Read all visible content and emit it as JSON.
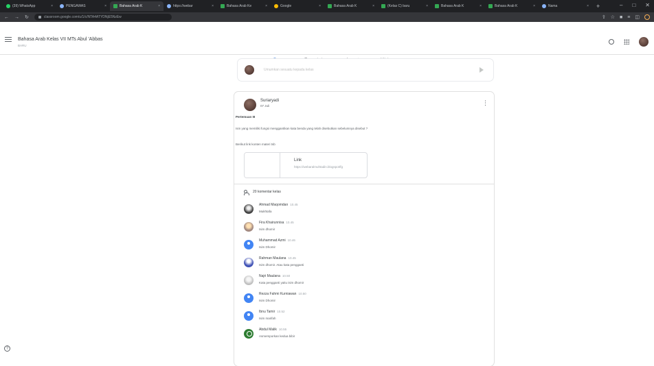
{
  "browser": {
    "tabs": [
      {
        "label": "(39) WhatsApp",
        "icon": "whatsapp-icon"
      },
      {
        "label": "PENGAWAS",
        "icon": "globe-icon"
      },
      {
        "label": "Bahasa Arab K",
        "icon": "classroom-icon",
        "active": true
      },
      {
        "label": "https://webar",
        "icon": "globe-icon"
      },
      {
        "label": "Bahasa Arab Ke",
        "icon": "classroom-icon"
      },
      {
        "label": "Google",
        "icon": "google-icon"
      },
      {
        "label": "Bahasa Arab K",
        "icon": "classroom-icon"
      },
      {
        "label": "(Kelas C) baru",
        "icon": "classroom-icon"
      },
      {
        "label": "Bahasa Arab K",
        "icon": "classroom-icon"
      },
      {
        "label": "Bahasa Arab K",
        "icon": "classroom-icon"
      },
      {
        "label": "Nama",
        "icon": "globe-icon"
      }
    ],
    "url": "classroom.google.com/u/1/c/NTA4ATYDNjE5NzEw"
  },
  "header": {
    "class_name": "Bahasa Arab Kelas VII MTs Abul 'Abbas",
    "class_sub": "BARU",
    "tabs": [
      "Forum",
      "Tugas kelas",
      "Anggota",
      "Nilai"
    ],
    "active_tab": "Forum"
  },
  "announce": {
    "placeholder": "Umumkan sesuatu kepada kelas"
  },
  "post": {
    "author": "Suriaryadi",
    "date": "07 Juli",
    "title": "Pertemuan III",
    "question": "Ism yang memiliki fungsi menggantikan kata benda yang telah disebutkan sebelumnya disebut ?",
    "line2": "Berikut link konten materi tsb",
    "link": {
      "title": "Link",
      "url": "https://webaralmuhtadin.blogspot/fg"
    },
    "comment_count_label": "20 komentar kelas",
    "comments": [
      {
        "name": "Ahmad Maqomdan",
        "time": "10.45",
        "text": "Mukhtafa",
        "avatar": "photo1"
      },
      {
        "name": "Fira Khairunnisa",
        "time": "10.45",
        "text": "Isim dhomir",
        "avatar": "photo2"
      },
      {
        "name": "Muhammad Azmi",
        "time": "10.46",
        "text": "Isim Dhomir",
        "avatar": "blue"
      },
      {
        "name": "Rahman Maulana",
        "time": "10.45",
        "text": "Isim dhomir. Atau kata pengganti",
        "avatar": "photo3"
      },
      {
        "name": "Najri Maulana",
        "time": "10.50",
        "text": "Kata pengganti yaitu isim dhomir",
        "avatar": "photo4"
      },
      {
        "name": "Rezza Fahmi Kurniawan",
        "time": "10.50",
        "text": "Isim Dhomir",
        "avatar": "blue"
      },
      {
        "name": "Ibnu Tamir",
        "time": "10.52",
        "text": "Isim marifah",
        "avatar": "blue"
      },
      {
        "name": "Abdul Malik",
        "time": "10.55",
        "text": "Asmemporkan kedua bibir",
        "avatar": "green"
      }
    ]
  }
}
